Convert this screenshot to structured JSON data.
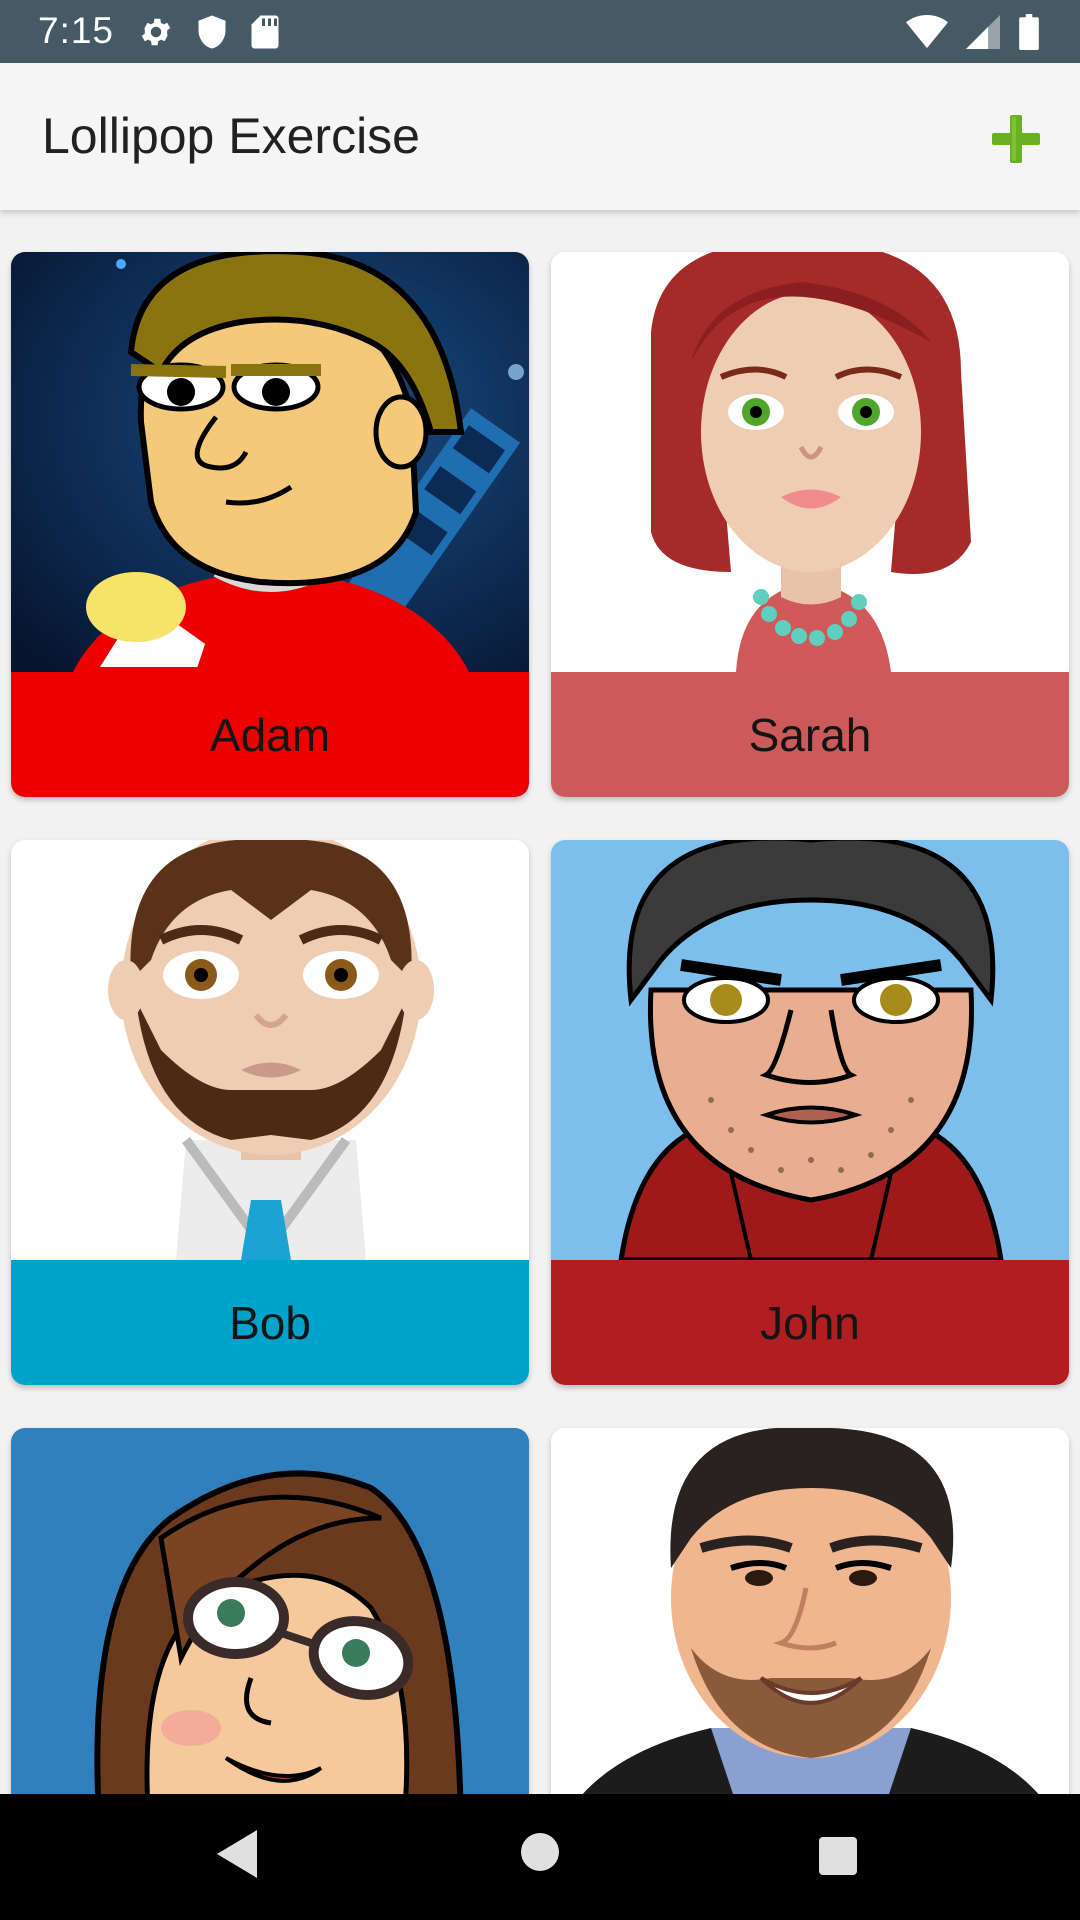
{
  "status_bar": {
    "time": "7:15",
    "icons": [
      "gear-icon",
      "shield-icon",
      "sd-card-icon",
      "wifi-icon",
      "signal-icon",
      "battery-icon"
    ]
  },
  "app_bar": {
    "title": "Lollipop Exercise",
    "add_icon": "plus-icon",
    "add_color": "#6ab023"
  },
  "cards": [
    {
      "name": "Adam",
      "color": "#ee0000"
    },
    {
      "name": "Sarah",
      "color": "#cd5a5a"
    },
    {
      "name": "Bob",
      "color": "#00a3cc"
    },
    {
      "name": "John",
      "color": "#b01e22"
    },
    {
      "name": "",
      "color": "#2f80bd"
    },
    {
      "name": "",
      "color": "#ffffff"
    }
  ],
  "nav_bar": {
    "icons": [
      "back-icon",
      "home-icon",
      "recents-icon"
    ]
  }
}
